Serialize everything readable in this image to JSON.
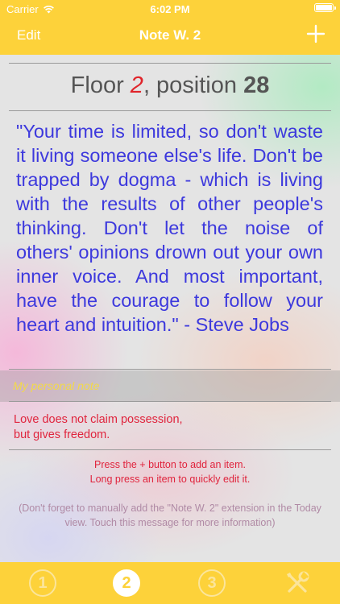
{
  "status_bar": {
    "carrier": "Carrier",
    "time": "6:02 PM"
  },
  "nav": {
    "edit_label": "Edit",
    "title": "Note W. 2",
    "add_icon": "plus-icon"
  },
  "floor": {
    "prefix": "Floor ",
    "floor_number": "2",
    "middle": ", position ",
    "position_number": "28"
  },
  "quote": {
    "text": "\"Your time is limited, so don't waste it living someone else's life. Don't be trapped by dogma - which is living with the results of other people's thinking. Don't let the noise of others' opinions drown out your own inner voice. And most important, have the courage to follow your heart and intuition.\" - Steve Jobs"
  },
  "personal_note": {
    "label": "My personal note",
    "line1": "Love does not claim possession,",
    "line2": "but gives freedom."
  },
  "help": {
    "line1": "Press the + button to add an item.",
    "line2": "Long press an item to quickly edit it."
  },
  "reminder": {
    "text": "(Don't forget to manually add the \"Note W. 2\" extension in the Today view. Touch this message for more information)"
  },
  "tabs": [
    {
      "label": "1",
      "icon": "circled-1-icon",
      "active": false
    },
    {
      "label": "2",
      "icon": "circled-2-icon",
      "active": true
    },
    {
      "label": "3",
      "icon": "circled-3-icon",
      "active": false
    },
    {
      "label": "",
      "icon": "tools-icon",
      "active": false
    }
  ],
  "colors": {
    "nav_background": "#fdd23a",
    "quote_text": "#3d39dd",
    "accent_red": "#e0242a",
    "personal_label": "#f2d94a"
  }
}
